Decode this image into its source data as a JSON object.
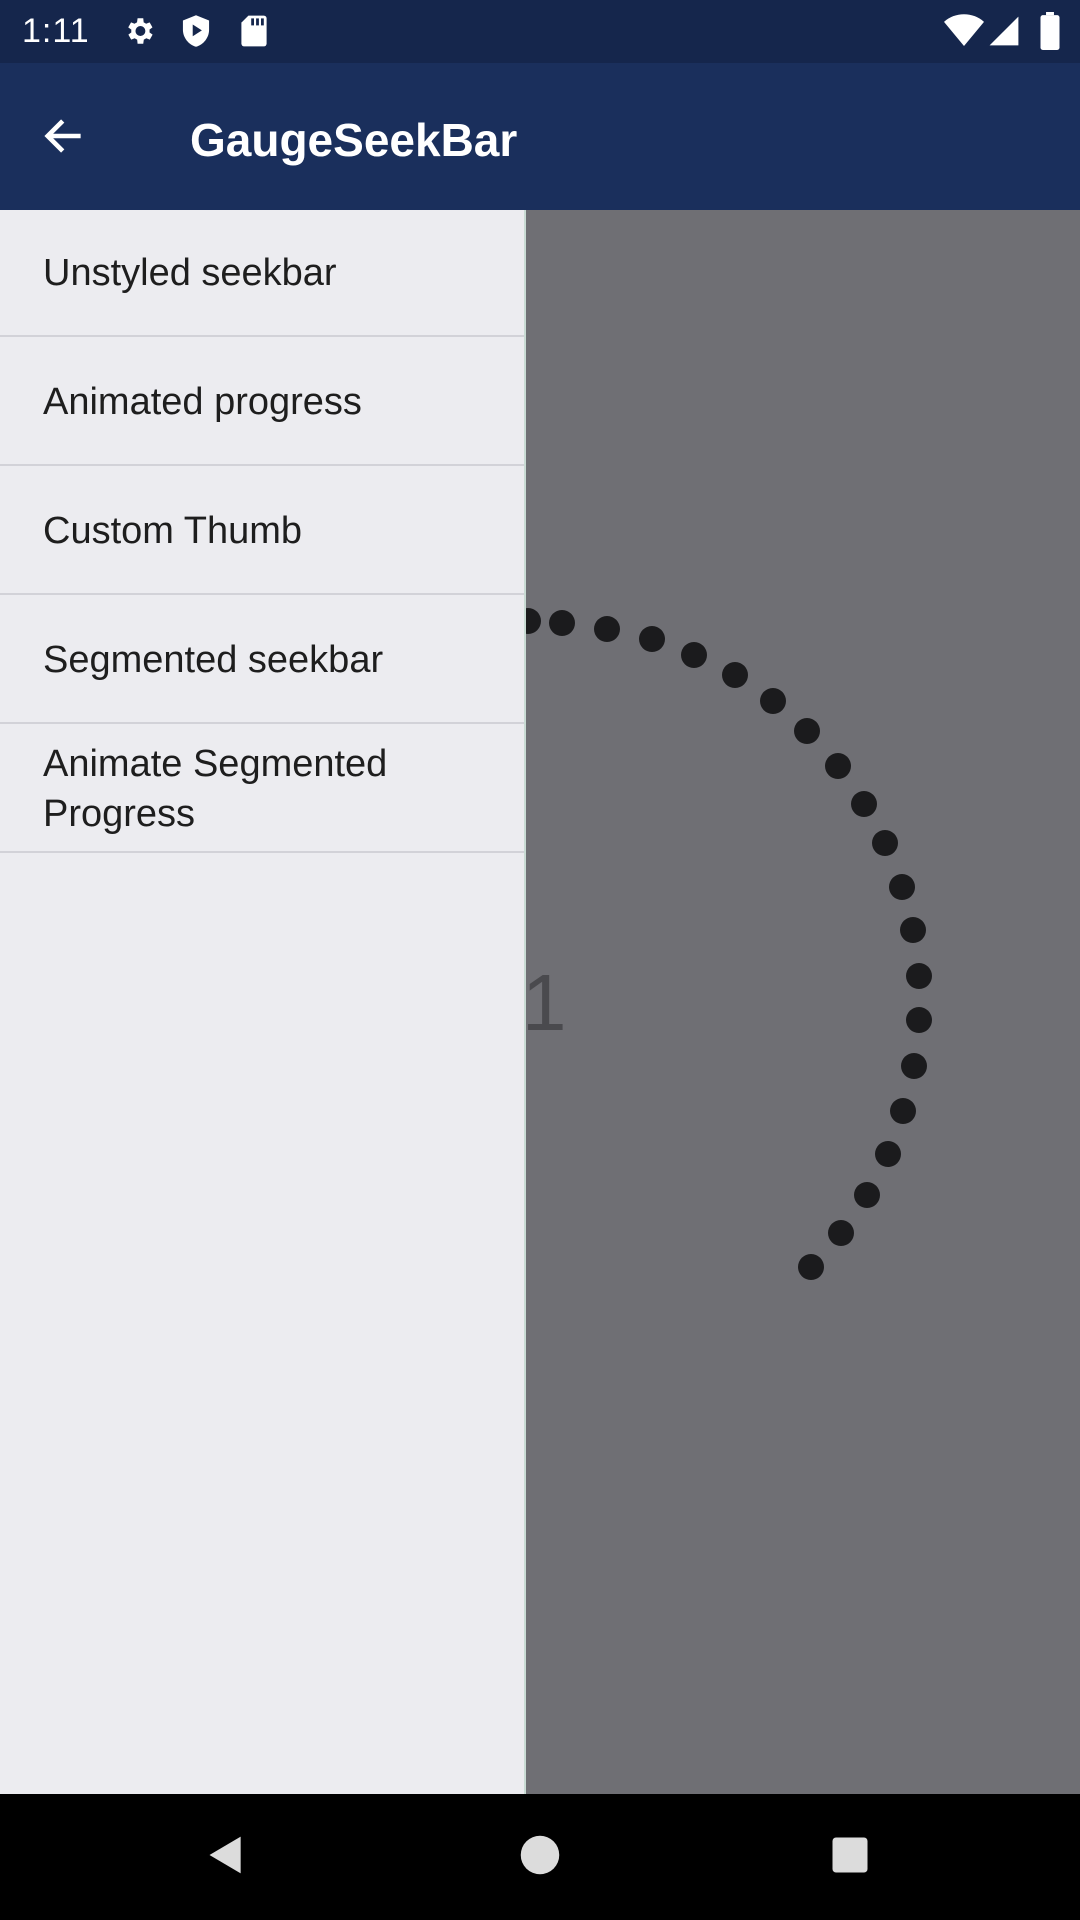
{
  "status_bar": {
    "time": "1:11",
    "icons_left": [
      "gear-icon",
      "play-shield-icon",
      "sd-card-icon"
    ],
    "icons_right": [
      "wifi-icon",
      "signal-icon",
      "battery-icon"
    ]
  },
  "app_bar": {
    "title": "GaugeSeekBar",
    "back_icon": "arrow-back-icon"
  },
  "drawer": {
    "items": [
      {
        "label": "Unstyled seekbar"
      },
      {
        "label": "Animated progress"
      },
      {
        "label": "Custom Thumb"
      },
      {
        "label": "Segmented seekbar"
      },
      {
        "label": "Animate Segmented\nProgress"
      }
    ]
  },
  "content": {
    "gauge_value_text": "1"
  },
  "nav_bar": {
    "buttons": [
      "back-triangle-icon",
      "home-circle-icon",
      "recents-square-icon"
    ]
  },
  "colors": {
    "status_bar": "#15264c",
    "app_bar": "#1a2f5c",
    "drawer": "#ececf0",
    "scrim": "#6f6f74",
    "dots": "#1b1b1d"
  }
}
